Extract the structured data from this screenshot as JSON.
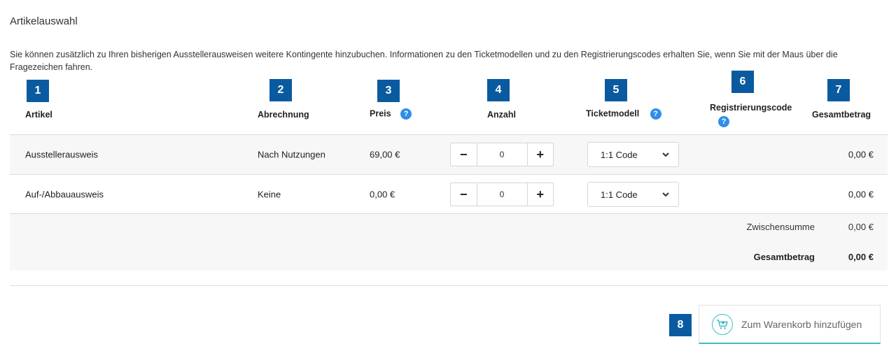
{
  "section_title": "Artikelauswahl",
  "intro_text": "Sie können zusätzlich zu Ihren bisherigen Ausstellerausweisen weitere Kontingente hinzubuchen. Informationen zu den Ticketmodellen und zu den Registrierungscodes erhalten Sie, wenn Sie mit der Maus über die Fragezeichen fahren.",
  "badges": [
    "1",
    "2",
    "3",
    "4",
    "5",
    "6",
    "7",
    "8"
  ],
  "columns": {
    "artikel": "Artikel",
    "abrechnung": "Abrechnung",
    "preis": "Preis",
    "anzahl": "Anzahl",
    "ticketmodell": "Ticketmodell",
    "registrierungscode": "Registrierungscode",
    "gesamtbetrag": "Gesamtbetrag"
  },
  "help_glyph": "?",
  "rows": [
    {
      "artikel": "Ausstellerausweis",
      "abrechnung": "Nach Nutzungen",
      "preis": "69,00 €",
      "anzahl": "0",
      "ticketmodell": "1:1 Code",
      "gesamtbetrag": "0,00 €"
    },
    {
      "artikel": "Auf-/Abbauausweis",
      "abrechnung": "Keine",
      "preis": "0,00 €",
      "anzahl": "0",
      "ticketmodell": "1:1 Code",
      "gesamtbetrag": "0,00 €"
    }
  ],
  "stepper": {
    "minus": "−",
    "plus": "+"
  },
  "summary": {
    "zwischensumme_label": "Zwischensumme",
    "zwischensumme_value": "0,00 €",
    "gesamtbetrag_label": "Gesamtbetrag",
    "gesamtbetrag_value": "0,00 €"
  },
  "cart_button_label": "Zum Warenkorb hinzufügen",
  "colors": {
    "badge": "#0a5aa0",
    "help": "#2f8ee8",
    "accent": "#3bbfc4"
  },
  "icons": {
    "help": "question-circle-icon",
    "cart": "cart-add-icon",
    "select": "chevron-down-icon"
  }
}
